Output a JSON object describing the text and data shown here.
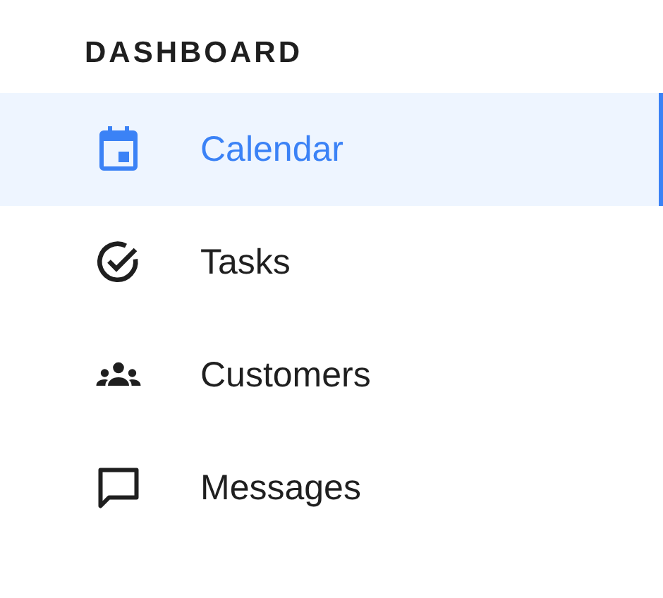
{
  "sidebar": {
    "heading": "DASHBOARD",
    "items": [
      {
        "label": "Calendar",
        "selected": true
      },
      {
        "label": "Tasks",
        "selected": false
      },
      {
        "label": "Customers",
        "selected": false
      },
      {
        "label": "Messages",
        "selected": false
      }
    ]
  }
}
